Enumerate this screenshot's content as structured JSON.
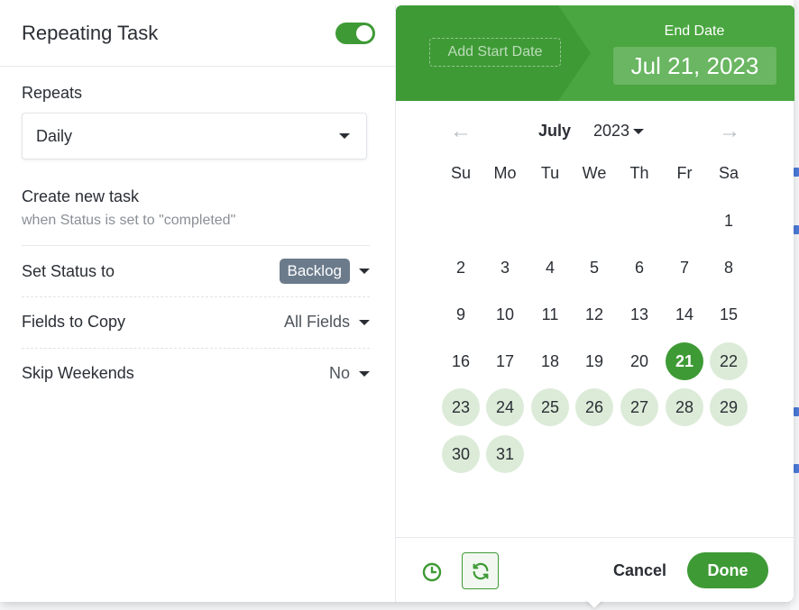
{
  "left": {
    "title": "Repeating Task",
    "toggle_on": true,
    "repeats_label": "Repeats",
    "repeats_value": "Daily",
    "create_title": "Create new task",
    "create_subtitle": "when Status is set to \"completed\"",
    "status_label": "Set Status to",
    "status_value": "Backlog",
    "fields_label": "Fields to Copy",
    "fields_value": "All Fields",
    "skip_label": "Skip Weekends",
    "skip_value": "No"
  },
  "right": {
    "add_start": "Add Start Date",
    "end_label": "End Date",
    "end_value": "Jul 21, 2023",
    "prev_arrow": "←",
    "next_arrow": "→",
    "month": "July",
    "year": "2023",
    "weekdays": [
      "Su",
      "Mo",
      "Tu",
      "We",
      "Th",
      "Fr",
      "Sa"
    ],
    "weeks": [
      [
        "",
        "",
        "",
        "",
        "",
        "",
        "1"
      ],
      [
        "2",
        "3",
        "4",
        "5",
        "6",
        "7",
        "8"
      ],
      [
        "9",
        "10",
        "11",
        "12",
        "13",
        "14",
        "15"
      ],
      [
        "16",
        "17",
        "18",
        "19",
        "20",
        "21",
        "22"
      ],
      [
        "23",
        "24",
        "25",
        "26",
        "27",
        "28",
        "29"
      ],
      [
        "30",
        "31",
        "",
        "",
        "",
        "",
        ""
      ]
    ],
    "selected_day": "21",
    "range_days": [
      "22",
      "23",
      "24",
      "25",
      "26",
      "27",
      "28",
      "29",
      "30",
      "31"
    ],
    "cancel_label": "Cancel",
    "done_label": "Done"
  },
  "colors": {
    "accent": "#3e9a35",
    "range": "#dcebd8",
    "badge": "#6b7b8c"
  }
}
